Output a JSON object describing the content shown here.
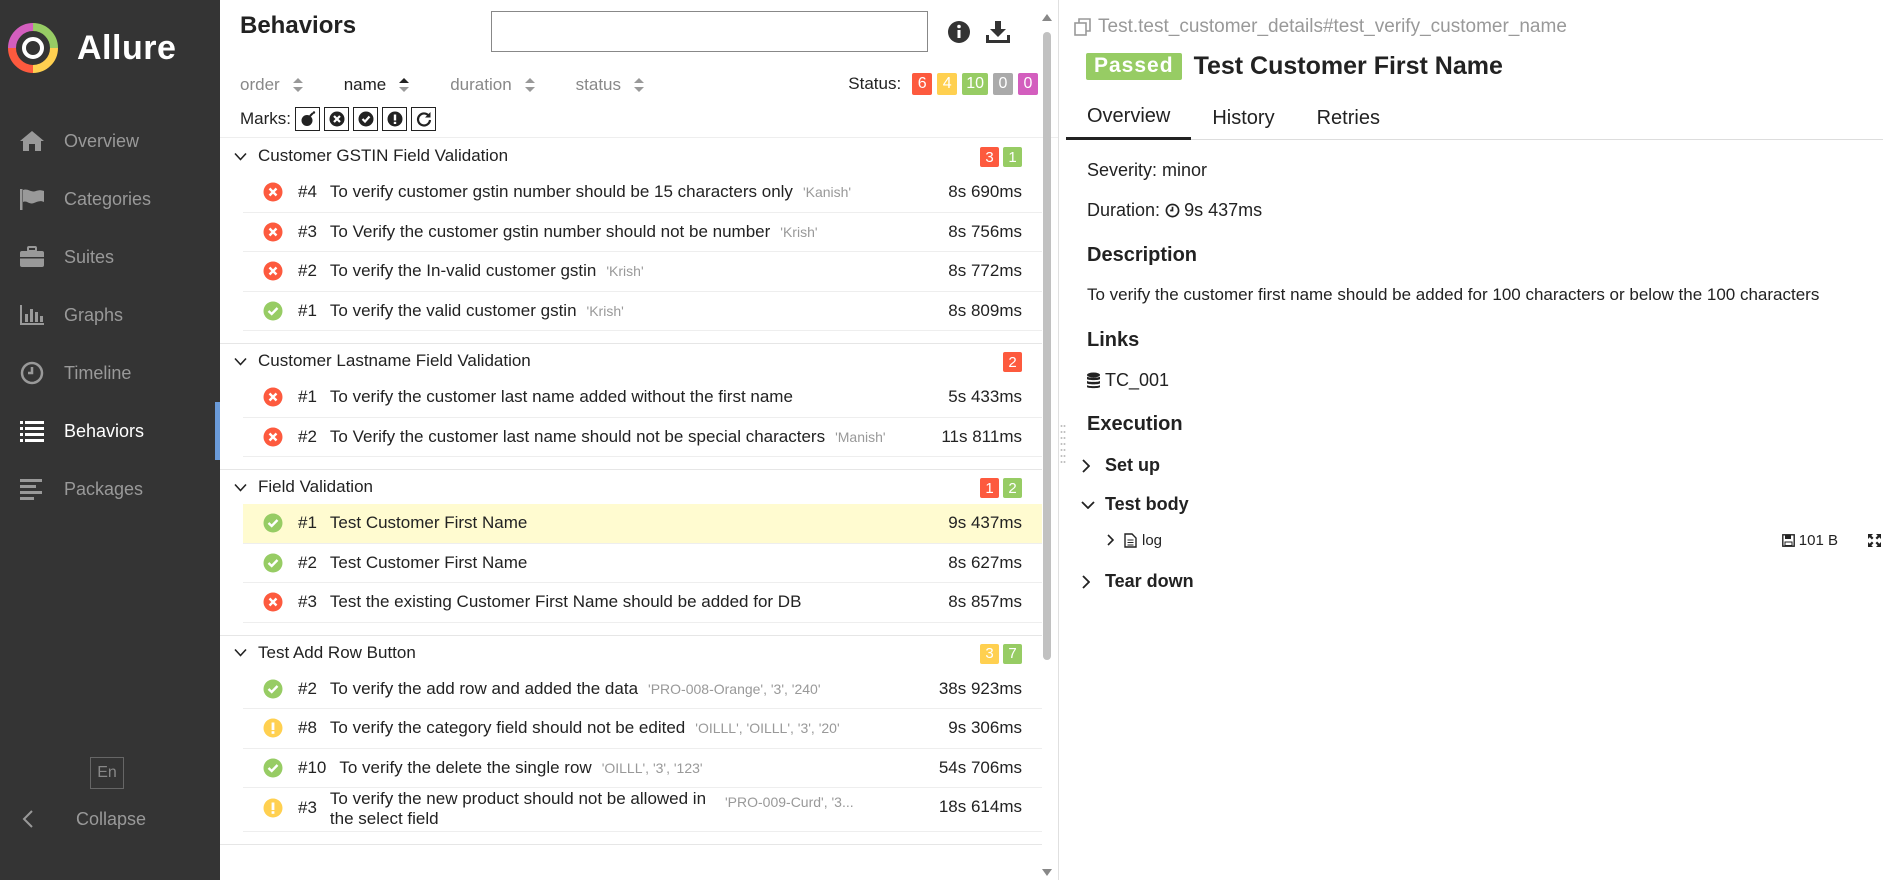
{
  "sidebar": {
    "brand": "Allure",
    "items": [
      {
        "label": "Overview",
        "icon": "home-icon"
      },
      {
        "label": "Categories",
        "icon": "flag-icon"
      },
      {
        "label": "Suites",
        "icon": "briefcase-icon"
      },
      {
        "label": "Graphs",
        "icon": "bar-chart-icon"
      },
      {
        "label": "Timeline",
        "icon": "clock-icon"
      },
      {
        "label": "Behaviors",
        "icon": "list-icon",
        "active": true
      },
      {
        "label": "Packages",
        "icon": "align-left-icon"
      }
    ],
    "language": "En",
    "collapse": "Collapse"
  },
  "middle": {
    "title": "Behaviors",
    "search": {
      "value": "",
      "placeholder": ""
    },
    "sort": [
      {
        "label": "order"
      },
      {
        "label": "name",
        "active": true
      },
      {
        "label": "duration"
      },
      {
        "label": "status"
      }
    ],
    "status_label": "Status:",
    "status_counts": {
      "failed": "6",
      "broken": "4",
      "passed": "10",
      "skipped": "0",
      "unknown": "0"
    },
    "marks_label": "Marks:",
    "groups": [
      {
        "name": "Customer GSTIN Field Validation",
        "counts": [
          {
            "value": "3",
            "status": "failed"
          },
          {
            "value": "1",
            "status": "passed"
          }
        ],
        "rows": [
          {
            "status": "failed",
            "num": "#4",
            "name": "To verify customer gstin number should be 15 characters only",
            "params": "'Kanish'",
            "duration": "8s 690ms"
          },
          {
            "status": "failed",
            "num": "#3",
            "name": "To Verify the customer gstin number should not be number",
            "params": "'Krish'",
            "duration": "8s 756ms"
          },
          {
            "status": "failed",
            "num": "#2",
            "name": "To verify the In-valid customer gstin",
            "params": "'Krish'",
            "duration": "8s 772ms"
          },
          {
            "status": "passed",
            "num": "#1",
            "name": "To verify the valid customer gstin",
            "params": "'Krish'",
            "duration": "8s 809ms"
          }
        ]
      },
      {
        "name": "Customer Lastname Field Validation",
        "counts": [
          {
            "value": "2",
            "status": "failed"
          }
        ],
        "rows": [
          {
            "status": "failed",
            "num": "#1",
            "name": "To verify the customer last name added without the first name",
            "params": "",
            "duration": "5s 433ms"
          },
          {
            "status": "failed",
            "num": "#2",
            "name": "To Verify the customer last name should not be special characters",
            "params": "'Manish'",
            "duration": "11s 811ms"
          }
        ]
      },
      {
        "name": "Field Validation",
        "counts": [
          {
            "value": "1",
            "status": "failed"
          },
          {
            "value": "2",
            "status": "passed"
          }
        ],
        "rows": [
          {
            "status": "passed",
            "num": "#1",
            "name": "Test Customer First Name",
            "params": "",
            "duration": "9s 437ms",
            "selected": true
          },
          {
            "status": "passed",
            "num": "#2",
            "name": "Test Customer First Name",
            "params": "",
            "duration": "8s 627ms"
          },
          {
            "status": "failed",
            "num": "#3",
            "name": "Test the existing Customer First Name should be added for DB",
            "params": "",
            "duration": "8s 857ms"
          }
        ]
      },
      {
        "name": "Test Add Row Button",
        "counts": [
          {
            "value": "3",
            "status": "broken"
          },
          {
            "value": "7",
            "status": "passed"
          }
        ],
        "rows": [
          {
            "status": "passed",
            "num": "#2",
            "name": "To verify the add row and added the data",
            "params": "'PRO-008-Orange', '3', '240'",
            "duration": "38s 923ms"
          },
          {
            "status": "broken",
            "num": "#8",
            "name": "To verify the category field should not be edited",
            "params": "'OILLL', 'OILLL', '3', '20'",
            "duration": "9s 306ms"
          },
          {
            "status": "passed",
            "num": "#10",
            "name": "To verify the delete the single row",
            "params": "'OILLL', '3', '123'",
            "duration": "54s 706ms"
          },
          {
            "status": "broken",
            "num": "#3",
            "name": "To verify the new product should not be allowed in the select field",
            "params": "'PRO-009-Curd', '3...",
            "duration": "18s 614ms"
          }
        ]
      }
    ]
  },
  "detail": {
    "breadcrumb": "Test.test_customer_details#test_verify_customer_name",
    "status_badge": "Passed",
    "title": "Test Customer First Name",
    "tabs": [
      "Overview",
      "History",
      "Retries"
    ],
    "severity_label": "Severity:",
    "severity": "minor",
    "duration_label": "Duration:",
    "duration": "9s 437ms",
    "description_heading": "Description",
    "description": "To verify the customer first name should be added for 100 characters or below the 100 characters",
    "links_heading": "Links",
    "link": "TC_001",
    "execution_heading": "Execution",
    "steps": [
      {
        "label": "Set up",
        "expanded": false
      },
      {
        "label": "Test body",
        "expanded": true
      },
      {
        "label": "Tear down",
        "expanded": false
      }
    ],
    "attachment": {
      "name": "log",
      "size": "101 B"
    }
  },
  "colors": {
    "sidebar_bg": "#343434",
    "failed": "#fd5a3e",
    "broken": "#ffd050",
    "passed": "#97cc64",
    "skipped": "#aaaaaa",
    "unknown": "#d35ebe",
    "selected_row": "#fffbd0",
    "active_indicator": "#6a9ad8"
  }
}
